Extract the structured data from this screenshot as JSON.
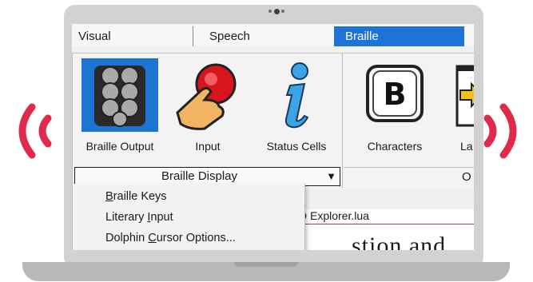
{
  "tabs": [
    {
      "label": "Visual",
      "selected": false
    },
    {
      "label": "Speech",
      "selected": false
    },
    {
      "label": "Braille",
      "selected": true
    }
  ],
  "ribbon": {
    "buttons": [
      {
        "label": "Braille Output",
        "icon": "braille-cell-icon",
        "selected": true
      },
      {
        "label": "Input",
        "icon": "finger-press-button-icon",
        "selected": false
      },
      {
        "label": "Status Cells",
        "icon": "info-i-icon",
        "selected": false
      },
      {
        "label": "Characters",
        "icon": "letter-b-key-icon",
        "selected": false
      },
      {
        "label": "La",
        "icon": "arrow-document-icon",
        "selected": false
      }
    ],
    "group_combo": {
      "label": "Braille Display",
      "arrow": "▼"
    },
    "right_group_label": "O"
  },
  "menu": {
    "items": [
      {
        "mnemonic": "B",
        "rest": "raille Keys"
      },
      {
        "before": "Literary ",
        "mnemonic": "I",
        "rest": "nput"
      },
      {
        "before": "Dolphin ",
        "mnemonic": "C",
        "rest": "ursor Options..."
      }
    ]
  },
  "document": {
    "tab_title": "D Explorer.lua",
    "visible_text": "stion and"
  },
  "colors": {
    "accent": "#1d74d6",
    "signal": "#e02a4b",
    "laptop": "#d2d2d2"
  }
}
